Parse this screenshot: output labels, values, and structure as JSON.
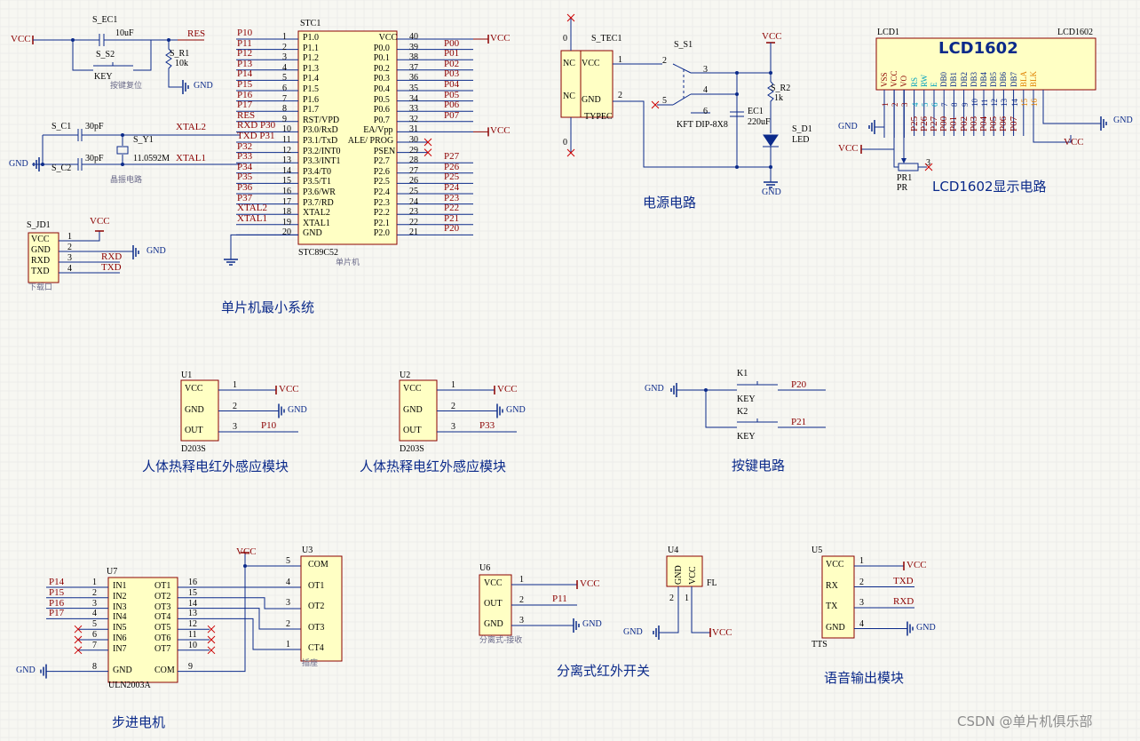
{
  "captions": {
    "mcu": "单片机最小系统",
    "power": "电源电路",
    "lcd": "LCD1602显示电路",
    "pir1": "人体热释电红外感应模块",
    "pir2": "人体热释电红外感应模块",
    "keys": "按键电路",
    "motor": "步进电机",
    "ir": "分离式红外开关",
    "tts": "语音输出模块"
  },
  "watermark": "CSDN @单片机俱乐部",
  "mcu": {
    "designator": "STC1",
    "part": "STC89C52",
    "note": "单片机",
    "left_pins": [
      {
        "num": "1",
        "name": "P1.0",
        "net": "P10"
      },
      {
        "num": "2",
        "name": "P1.1",
        "net": "P11"
      },
      {
        "num": "3",
        "name": "P1.2",
        "net": "P12"
      },
      {
        "num": "4",
        "name": "P1.3",
        "net": "P13"
      },
      {
        "num": "5",
        "name": "P1.4",
        "net": "P14"
      },
      {
        "num": "6",
        "name": "P1.5",
        "net": "P15"
      },
      {
        "num": "7",
        "name": "P1.6",
        "net": "P16"
      },
      {
        "num": "8",
        "name": "P1.7",
        "net": "P17"
      },
      {
        "num": "9",
        "name": "RST/VPD",
        "net": "RES"
      },
      {
        "num": "10",
        "name": "P3.0/RxD",
        "net": "RXD P30"
      },
      {
        "num": "11",
        "name": "P3.1/TxD",
        "net": "TXD P31"
      },
      {
        "num": "12",
        "name": "P3.2/INT0",
        "net": "P32"
      },
      {
        "num": "13",
        "name": "P3.3/INT1",
        "net": "P33"
      },
      {
        "num": "14",
        "name": "P3.4/T0",
        "net": "P34"
      },
      {
        "num": "15",
        "name": "P3.5/T1",
        "net": "P35"
      },
      {
        "num": "16",
        "name": "P3.6/WR",
        "net": "P36"
      },
      {
        "num": "17",
        "name": "P3.7/RD",
        "net": "P37"
      },
      {
        "num": "18",
        "name": "XTAL2",
        "net": "XTAL2"
      },
      {
        "num": "19",
        "name": "XTAL1",
        "net": "XTAL1"
      },
      {
        "num": "20",
        "name": "GND",
        "net": ""
      }
    ],
    "right_pins": [
      {
        "num": "40",
        "name": "VCC",
        "net": "VCC"
      },
      {
        "num": "39",
        "name": "P0.0",
        "net": "P00"
      },
      {
        "num": "38",
        "name": "P0.1",
        "net": "P01"
      },
      {
        "num": "37",
        "name": "P0.2",
        "net": "P02"
      },
      {
        "num": "36",
        "name": "P0.3",
        "net": "P03"
      },
      {
        "num": "35",
        "name": "P0.4",
        "net": "P04"
      },
      {
        "num": "34",
        "name": "P0.5",
        "net": "P05"
      },
      {
        "num": "33",
        "name": "P0.6",
        "net": "P06"
      },
      {
        "num": "32",
        "name": "P0.7",
        "net": "P07"
      },
      {
        "num": "31",
        "name": "EA/Vpp",
        "net": "VCC"
      },
      {
        "num": "30",
        "name": "ALE/ PROG",
        "net": ""
      },
      {
        "num": "29",
        "name": "PSEN",
        "net": ""
      },
      {
        "num": "28",
        "name": "P2.7",
        "net": "P27"
      },
      {
        "num": "27",
        "name": "P2.6",
        "net": "P26"
      },
      {
        "num": "26",
        "name": "P2.5",
        "net": "P25"
      },
      {
        "num": "25",
        "name": "P2.4",
        "net": "P24"
      },
      {
        "num": "24",
        "name": "P2.3",
        "net": "P23"
      },
      {
        "num": "23",
        "name": "P2.2",
        "net": "P22"
      },
      {
        "num": "22",
        "name": "P2.1",
        "net": "P21"
      },
      {
        "num": "21",
        "name": "P2.0",
        "net": "P20"
      }
    ]
  },
  "reset": {
    "vcc": "VCC",
    "ec1": "S_EC1",
    "ec1_val": "10uF",
    "s2": "S_S2",
    "key": "KEY",
    "r1": "S_R1",
    "r1_val": "10k",
    "res": "RES",
    "gnd": "GND",
    "note": "按键复位"
  },
  "crystal": {
    "c1": "S_C1",
    "c1_val": "30pF",
    "c2": "S_C2",
    "c2_val": "30pF",
    "y1": "S_Y1",
    "y1_val": "11.0592M",
    "xtal2": "XTAL2",
    "xtal1": "XTAL1",
    "gnd": "GND",
    "note": "晶振电路"
  },
  "download": {
    "designator": "S_JD1",
    "vcc": "VCC",
    "gnd": "GND",
    "note": "下载口",
    "pins": [
      {
        "num": "1",
        "name": "VCC",
        "net": ""
      },
      {
        "num": "2",
        "name": "GND",
        "net": "GND"
      },
      {
        "num": "3",
        "name": "RXD",
        "net": "RXD"
      },
      {
        "num": "4",
        "name": "TXD",
        "net": "TXD"
      }
    ]
  },
  "power": {
    "designator": "S_TEC1",
    "part": "TYPEC",
    "nc1": "NC",
    "nc2": "NC",
    "vcc_pin": "VCC",
    "gnd_pin": "GND",
    "pin1": "1",
    "pin2": "2",
    "zero1": "0",
    "zero2": "0",
    "switch": "S_S1",
    "switch_part": "KFT DIP-8X8",
    "sw_pins": [
      "2",
      "3",
      "4",
      "5",
      "6"
    ],
    "vcc": "VCC",
    "gnd": "GND",
    "r2": "S_R2",
    "r2_val": "1k",
    "ec": "EC1",
    "ec_val": "220uF",
    "led": "S_D1",
    "led_val": "LED"
  },
  "lcd": {
    "designator": "LCD1",
    "part_right": "LCD1602",
    "title": "LCD1602",
    "gnd": "GND",
    "vcc": "VCC",
    "vcc2": "VCC",
    "gnd2": "GND",
    "pr": "PR1",
    "pr_val": "PR",
    "pr_pin3": "3",
    "pins": [
      {
        "num": "1",
        "name": "VSS",
        "net": ""
      },
      {
        "num": "2",
        "name": "VCC",
        "net": ""
      },
      {
        "num": "3",
        "name": "VO",
        "net": ""
      },
      {
        "num": "4",
        "name": "RS",
        "net": "P25"
      },
      {
        "num": "5",
        "name": "RW",
        "net": "P26"
      },
      {
        "num": "6",
        "name": "E",
        "net": "P27"
      },
      {
        "num": "7",
        "name": "DB0",
        "net": "P00"
      },
      {
        "num": "8",
        "name": "DB1",
        "net": "P01"
      },
      {
        "num": "9",
        "name": "DB2",
        "net": "P02"
      },
      {
        "num": "10",
        "name": "DB3",
        "net": "P03"
      },
      {
        "num": "11",
        "name": "DB4",
        "net": "P04"
      },
      {
        "num": "12",
        "name": "DB5",
        "net": "P05"
      },
      {
        "num": "13",
        "name": "DB6",
        "net": "P06"
      },
      {
        "num": "14",
        "name": "DB7",
        "net": "P07"
      },
      {
        "num": "15",
        "name": "BLA",
        "net": ""
      },
      {
        "num": "16",
        "name": "BLK",
        "net": ""
      }
    ]
  },
  "pir1": {
    "designator": "U1",
    "part": "D203S",
    "pins": [
      {
        "num": "1",
        "name": "VCC",
        "net": "VCC"
      },
      {
        "num": "2",
        "name": "GND",
        "net": "GND"
      },
      {
        "num": "3",
        "name": "OUT",
        "net": "P10"
      }
    ]
  },
  "pir2": {
    "designator": "U2",
    "part": "D203S",
    "pins": [
      {
        "num": "1",
        "name": "VCC",
        "net": "VCC"
      },
      {
        "num": "2",
        "name": "GND",
        "net": "GND"
      },
      {
        "num": "3",
        "name": "OUT",
        "net": "P33"
      }
    ]
  },
  "keys": {
    "gnd": "GND",
    "k1": "K1",
    "k1_part": "KEY",
    "k1_net": "P20",
    "k2": "K2",
    "k2_part": "KEY",
    "k2_net": "P21"
  },
  "uln": {
    "designator": "U7",
    "part": "ULN2003A",
    "gnd": "GND",
    "left_pins": [
      {
        "num": "1",
        "name": "IN1",
        "net": "P14"
      },
      {
        "num": "2",
        "name": "IN2",
        "net": "P15"
      },
      {
        "num": "3",
        "name": "IN3",
        "net": "P16"
      },
      {
        "num": "4",
        "name": "IN4",
        "net": "P17"
      },
      {
        "num": "5",
        "name": "IN5",
        "net": ""
      },
      {
        "num": "6",
        "name": "IN6",
        "net": ""
      },
      {
        "num": "7",
        "name": "IN7",
        "net": ""
      },
      {
        "num": "8",
        "name": "GND",
        "net": ""
      }
    ],
    "right_pins": [
      {
        "num": "16",
        "name": "OT1"
      },
      {
        "num": "15",
        "name": "OT2"
      },
      {
        "num": "14",
        "name": "OT3"
      },
      {
        "num": "13",
        "name": "OT4"
      },
      {
        "num": "12",
        "name": "OT5"
      },
      {
        "num": "11",
        "name": "OT6"
      },
      {
        "num": "10",
        "name": "OT7"
      },
      {
        "num": "9",
        "name": "COM"
      }
    ]
  },
  "socket": {
    "designator": "U3",
    "note": "插座",
    "vcc": "VCC",
    "pins": [
      {
        "num": "5",
        "name": "COM"
      },
      {
        "num": "4",
        "name": "OT1"
      },
      {
        "num": "3",
        "name": "OT2"
      },
      {
        "num": "2",
        "name": "OT3"
      },
      {
        "num": "1",
        "name": "CT4"
      }
    ]
  },
  "ir": {
    "designator": "U6",
    "note": "分离式-接收",
    "pins": [
      {
        "num": "1",
        "name": "VCC",
        "net": "VCC"
      },
      {
        "num": "2",
        "name": "OUT",
        "net": "P11"
      },
      {
        "num": "3",
        "name": "GND",
        "net": "GND"
      }
    ]
  },
  "fl": {
    "designator": "U4",
    "label": "FL",
    "pin_gnd": "GND",
    "pin_vcc": "VCC",
    "n2": "2",
    "n1": "1",
    "gnd": "GND",
    "vcc": "VCC"
  },
  "tts": {
    "designator": "U5",
    "part": "TTS",
    "pins": [
      {
        "num": "1",
        "name": "VCC",
        "net": "VCC"
      },
      {
        "num": "2",
        "name": "RX",
        "net": "TXD"
      },
      {
        "num": "3",
        "name": "TX",
        "net": "RXD"
      },
      {
        "num": "4",
        "name": "GND",
        "net": "GND"
      }
    ]
  }
}
